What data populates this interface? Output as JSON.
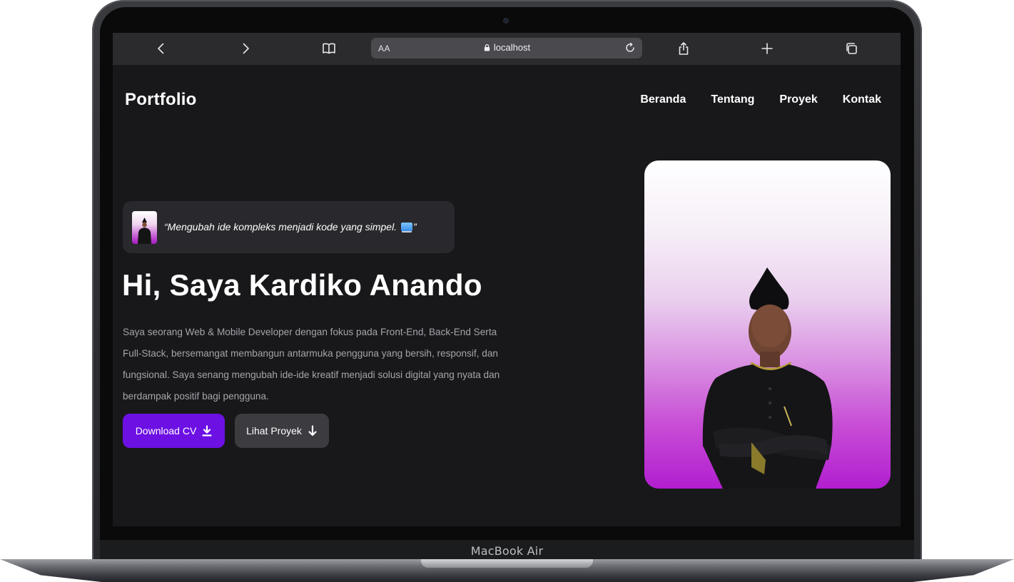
{
  "device": {
    "label": "MacBook Air"
  },
  "browser": {
    "text_size_label": "AA",
    "url": "localhost",
    "icons": {
      "back": "chevron-left-icon",
      "forward": "chevron-right-icon",
      "reader": "book-icon",
      "lock": "lock-icon",
      "reload": "reload-icon",
      "share": "share-icon",
      "new_tab": "plus-icon",
      "tabs": "tabs-icon"
    }
  },
  "header": {
    "brand": "Portfolio",
    "nav": [
      {
        "label": "Beranda"
      },
      {
        "label": "Tentang"
      },
      {
        "label": "Proyek"
      },
      {
        "label": "Kontak"
      }
    ]
  },
  "hero": {
    "quote": "“Mengubah ide kompleks menjadi kode yang simpel.",
    "quote_end": "”",
    "title": "Hi, Saya Kardiko Anando",
    "description": "Saya seorang Web & Mobile Developer dengan fokus pada Front-End, Back-End Serta Full-Stack, bersemangat membangun antarmuka pengguna yang bersih, responsif, dan fungsional. Saya senang mengubah ide-ide kreatif menjadi solusi digital yang nyata dan berdampak positif bagi pengguna.",
    "buttons": {
      "download_cv": "Download CV",
      "view_projects": "Lihat Proyek"
    }
  },
  "colors": {
    "page_bg": "#18181b",
    "accent": "#6c10e4",
    "secondary_button": "#3b3b40",
    "portrait_gradient_end": "#b21ed0"
  }
}
